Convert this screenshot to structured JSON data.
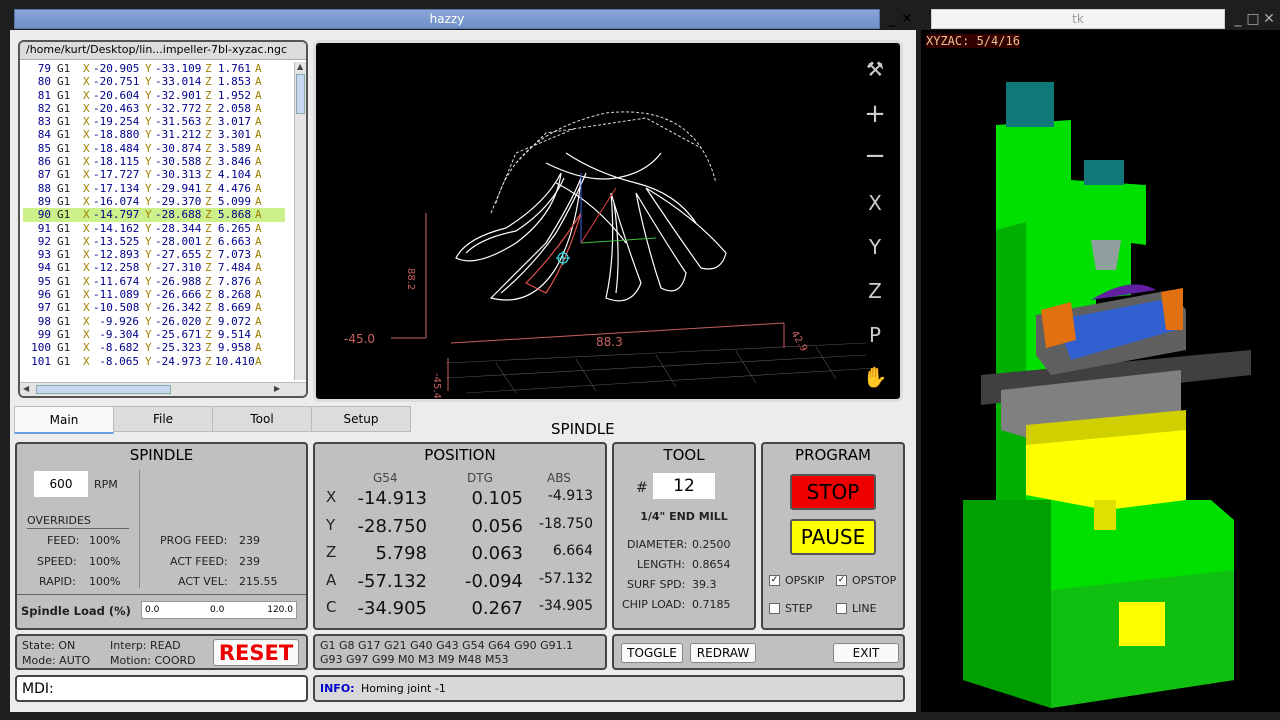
{
  "hazzy_window": {
    "title": "hazzy"
  },
  "tk_window": {
    "title": "tk"
  },
  "gcode": {
    "path": "/home/kurt/Desktop/lin...impeller-7bl-xyzac.ngc",
    "highlight_line": "90",
    "lines": [
      {
        "n": "79",
        "g": "G1",
        "x": "-20.905",
        "y": "-33.109",
        "z": "1.761"
      },
      {
        "n": "80",
        "g": "G1",
        "x": "-20.751",
        "y": "-33.014",
        "z": "1.853"
      },
      {
        "n": "81",
        "g": "G1",
        "x": "-20.604",
        "y": "-32.901",
        "z": "1.952"
      },
      {
        "n": "82",
        "g": "G1",
        "x": "-20.463",
        "y": "-32.772",
        "z": "2.058"
      },
      {
        "n": "83",
        "g": "G1",
        "x": "-19.254",
        "y": "-31.563",
        "z": "3.017"
      },
      {
        "n": "84",
        "g": "G1",
        "x": "-18.880",
        "y": "-31.212",
        "z": "3.301"
      },
      {
        "n": "85",
        "g": "G1",
        "x": "-18.484",
        "y": "-30.874",
        "z": "3.589"
      },
      {
        "n": "86",
        "g": "G1",
        "x": "-18.115",
        "y": "-30.588",
        "z": "3.846"
      },
      {
        "n": "87",
        "g": "G1",
        "x": "-17.727",
        "y": "-30.313",
        "z": "4.104"
      },
      {
        "n": "88",
        "g": "G1",
        "x": "-17.134",
        "y": "-29.941",
        "z": "4.476"
      },
      {
        "n": "89",
        "g": "G1",
        "x": "-16.074",
        "y": "-29.370",
        "z": "5.099"
      },
      {
        "n": "90",
        "g": "G1",
        "x": "-14.797",
        "y": "-28.688",
        "z": "5.868"
      },
      {
        "n": "91",
        "g": "G1",
        "x": "-14.162",
        "y": "-28.344",
        "z": "6.265"
      },
      {
        "n": "92",
        "g": "G1",
        "x": "-13.525",
        "y": "-28.001",
        "z": "6.663"
      },
      {
        "n": "93",
        "g": "G1",
        "x": "-12.893",
        "y": "-27.655",
        "z": "7.073"
      },
      {
        "n": "94",
        "g": "G1",
        "x": "-12.258",
        "y": "-27.310",
        "z": "7.484"
      },
      {
        "n": "95",
        "g": "G1",
        "x": "-11.674",
        "y": "-26.988",
        "z": "7.876"
      },
      {
        "n": "96",
        "g": "G1",
        "x": "-11.089",
        "y": "-26.666",
        "z": "8.268"
      },
      {
        "n": "97",
        "g": "G1",
        "x": "-10.508",
        "y": "-26.342",
        "z": "8.669"
      },
      {
        "n": "98",
        "g": "G1",
        "x": "-9.926",
        "y": "-26.020",
        "z": "9.072"
      },
      {
        "n": "99",
        "g": "G1",
        "x": "-9.304",
        "y": "-25.671",
        "z": "9.514"
      },
      {
        "n": "100",
        "g": "G1",
        "x": "-8.682",
        "y": "-25.323",
        "z": "9.958"
      },
      {
        "n": "101",
        "g": "G1",
        "x": "-8.065",
        "y": "-24.973",
        "z": "10.410"
      }
    ]
  },
  "preview": {
    "dim_x": "88.3",
    "dim_left": "-45.0",
    "dim_y": "88.2",
    "dim_z": "-45.4",
    "dim_r": "42.9",
    "tools": [
      "wrench-icon",
      "zoom-in-icon",
      "zoom-out-icon",
      "X",
      "Y",
      "Z",
      "P",
      "hand-icon"
    ],
    "tool_labels": {
      "x": "X",
      "y": "Y",
      "z": "Z",
      "p": "P"
    }
  },
  "tabs": [
    "Main",
    "File",
    "Tool",
    "Setup"
  ],
  "spindle_heading": "SPINDLE",
  "spindle": {
    "title": "SPINDLE",
    "rpm": "600",
    "rpm_unit": "RPM",
    "overrides": "OVERRIDES",
    "feed_label": "FEED:",
    "feed": "100%",
    "speed_label": "SPEED:",
    "speed": "100%",
    "rapid_label": "RAPID:",
    "rapid": "100%",
    "prog_feed_label": "PROG FEED:",
    "prog_feed": "239",
    "act_feed_label": "ACT FEED:",
    "act_feed": "239",
    "act_vel_label": "ACT VEL:",
    "act_vel": "215.55",
    "load_label": "Spindle Load (%)",
    "load_min": "0.0",
    "load_val": "0.0",
    "load_max": "120.0"
  },
  "position": {
    "title": "POSITION",
    "cols": [
      "G54",
      "DTG",
      "ABS"
    ],
    "rows": [
      {
        "axis": "X",
        "g54": "-14.913",
        "dtg": "0.105",
        "abs": "-4.913"
      },
      {
        "axis": "Y",
        "g54": "-28.750",
        "dtg": "0.056",
        "abs": "-18.750"
      },
      {
        "axis": "Z",
        "g54": "5.798",
        "dtg": "0.063",
        "abs": "6.664"
      },
      {
        "axis": "A",
        "g54": "-57.132",
        "dtg": "-0.094",
        "abs": "-57.132"
      },
      {
        "axis": "C",
        "g54": "-34.905",
        "dtg": "0.267",
        "abs": "-34.905"
      }
    ]
  },
  "tool": {
    "title": "TOOL",
    "hash": "#",
    "number": "12",
    "name": "1/4\" END MILL",
    "diameter_label": "DIAMETER:",
    "diameter": "0.2500",
    "length_label": "LENGTH:",
    "length": "0.8654",
    "surf_label": "SURF SPD:",
    "surf": "39.3",
    "chip_label": "CHIP LOAD:",
    "chip": "0.7185"
  },
  "program": {
    "title": "PROGRAM",
    "stop": "STOP",
    "pause": "PAUSE",
    "opskip": "OPSKIP",
    "opstop": "OPSTOP",
    "step": "STEP",
    "line": "LINE"
  },
  "status": {
    "state": "State: ON",
    "mode": "Mode: AUTO",
    "interp": "Interp: READ",
    "motion": "Motion: COORD",
    "reset": "RESET"
  },
  "gcodes_active": {
    "l1": "G1 G8 G17 G21 G40 G43 G54 G64 G90 G91.1",
    "l2": "G93 G97 G99 M0 M3 M9 M48 M53"
  },
  "buttons": {
    "toggle": "TOGGLE",
    "redraw": "REDRAW",
    "exit": "EXIT"
  },
  "mdi": {
    "label": "MDI:"
  },
  "info": {
    "label": "INFO:",
    "msg": "Homing joint -1"
  },
  "sim": {
    "label": "XYZAC: 5/4/16"
  }
}
